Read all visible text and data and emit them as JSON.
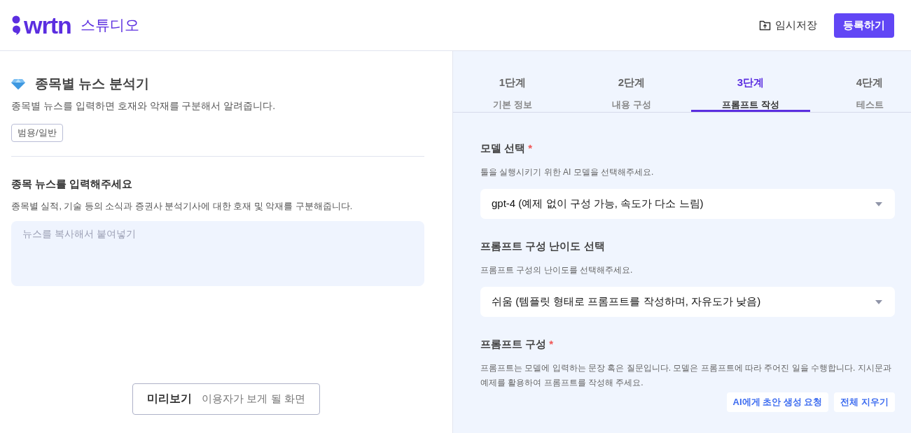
{
  "header": {
    "logo": "wrtn",
    "product": "스튜디오",
    "actions": [
      {
        "kind": "save",
        "label": "임시저장"
      },
      {
        "kind": "primary",
        "label": "등록하기"
      }
    ]
  },
  "tool": {
    "title": "종목별 뉴스 분석기",
    "description": "종목별 뉴스를 입력하면 호재와 악재를 구분해서 알려줍니다.",
    "tag": "범용/일반",
    "input": {
      "label": "종목 뉴스를 입력해주세요",
      "help": "종목별 실적, 기술 등의 소식과 증권사 분석기사에 대한 호재 및 악재를 구분해줍니다.",
      "placeholder": "뉴스를 복사해서 붙여넣기"
    },
    "preview": {
      "label": "미리보기",
      "caption": "이용자가 보게 될 화면"
    }
  },
  "steps": [
    {
      "number": "1단계",
      "name": "기본 정보",
      "selected": false
    },
    {
      "number": "2단계",
      "name": "내용 구성",
      "selected": false
    },
    {
      "number": "3단계",
      "name": "프롬프트 작성",
      "selected": true
    },
    {
      "number": "4단계",
      "name": "테스트",
      "selected": false
    }
  ],
  "form": [
    {
      "kind": "select",
      "label": "모델 선택",
      "required_mark": "*",
      "help": "툴을 실행시키기 위한 AI 모델을 선택해주세요.",
      "value": "gpt-4 (예제 없이 구성 가능, 속도가 다소 느림)"
    },
    {
      "kind": "select",
      "label": "프롬프트 구성 난이도 선택",
      "help": "프롬프트 구성의 난이도를 선택해주세요.",
      "value": "쉬움 (템플릿 형태로 프롬프트를 작성하며, 자유도가 낮음)"
    },
    {
      "kind": "actions",
      "label": "프롬프트 구성",
      "required_mark": "*",
      "help": "프롬프트는 모델에 입력하는 문장 혹은 질문입니다. 모델은 프롬프트에 따라 주어진 일을 수행합니다. 지시문과 예제를 활용하여 프롬프트를 작성해 주세요.",
      "buttons": [
        "AI에게 초안 생성 요청",
        "전체 지우기"
      ]
    }
  ]
}
